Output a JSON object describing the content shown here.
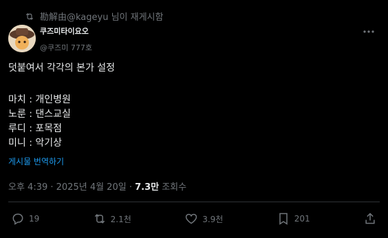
{
  "repost": {
    "text": "勘解由@kageyu 님이 재게시함"
  },
  "author": {
    "name": "쿠즈미타이요오",
    "handle": "@쿠즈미 777호"
  },
  "post": {
    "lines": [
      "덧붙여서 각각의 본가 설정",
      "",
      "마치 : 개인병원",
      "노룬 : 댄스교실",
      "루디 : 포목점",
      "미니 : 악기상"
    ],
    "translate_label": "게시물 번역하기"
  },
  "meta": {
    "time": "오후 4:39 · 2025년 4월 20일 · ",
    "views": "7.3만",
    "views_label": " 조회수"
  },
  "actions": {
    "replies": "19",
    "reposts": "2.1천",
    "likes": "3.9천",
    "bookmarks": "201"
  }
}
